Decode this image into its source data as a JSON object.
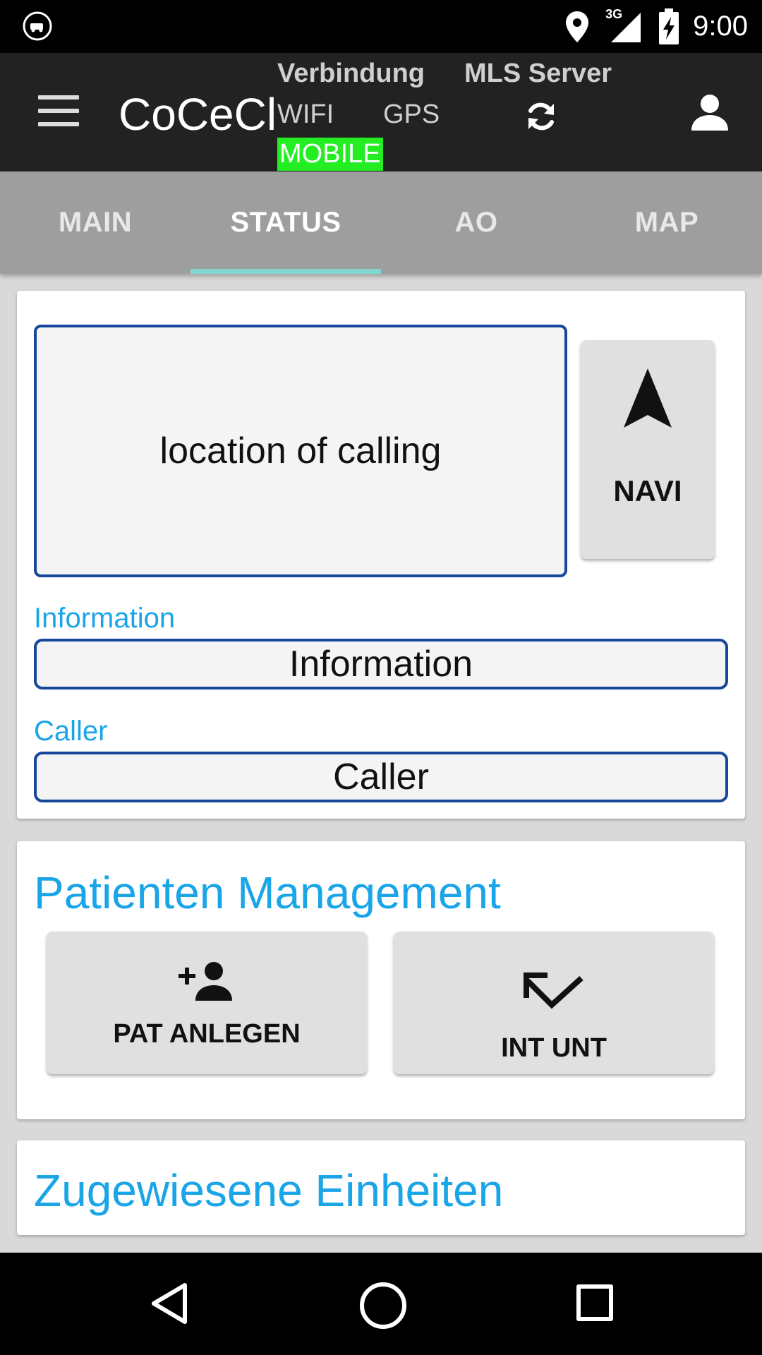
{
  "status_bar": {
    "time": "9:00",
    "network_type": "3G",
    "icons": [
      "notification-badge-icon",
      "location-icon",
      "signal-icon",
      "battery-charging-icon"
    ]
  },
  "app_bar": {
    "title": "CoCeCl",
    "connection_heading": "Verbindung",
    "mls_heading": "MLS Server",
    "wifi_label": "WIFI",
    "gps_label": "GPS",
    "mobile_label": "MOBILE",
    "mobile_active_color": "#22ee22",
    "icons": [
      "menu-icon",
      "sync-icon",
      "user-icon"
    ]
  },
  "tabs": [
    {
      "label": "MAIN",
      "active": false
    },
    {
      "label": "STATUS",
      "active": true
    },
    {
      "label": "AO",
      "active": false
    },
    {
      "label": "MAP",
      "active": false
    }
  ],
  "location_card": {
    "location_text": "location of calling",
    "navi_label": "NAVI",
    "information_label": "Information",
    "information_value": "Information",
    "caller_label": "Caller",
    "caller_value": "Caller"
  },
  "patient_card": {
    "title": "Patienten Management",
    "add_patient_label": "PAT ANLEGEN",
    "int_unt_label": "INT UNT"
  },
  "units_card": {
    "title": "Zugewiesene Einheiten"
  },
  "colors": {
    "accent_text": "#1aa5e8",
    "field_border": "#17479a",
    "tab_indicator": "#7fd7d0"
  }
}
